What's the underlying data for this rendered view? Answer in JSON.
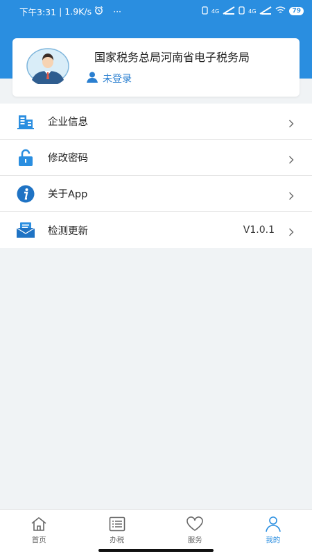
{
  "status_bar": {
    "time": "下午3:31",
    "speed": "1.9K/s",
    "dots": "···",
    "network_label": "4G",
    "battery": "79"
  },
  "profile": {
    "org_name": "国家税务总局河南省电子税务局",
    "login_status": "未登录"
  },
  "menu": {
    "items": [
      {
        "label": "企业信息",
        "icon": "building-icon",
        "value": ""
      },
      {
        "label": "修改密码",
        "icon": "lock-icon",
        "value": ""
      },
      {
        "label": "关于App",
        "icon": "info-icon",
        "value": ""
      },
      {
        "label": "检测更新",
        "icon": "mail-icon",
        "value": "V1.0.1"
      }
    ]
  },
  "bottom_nav": {
    "items": [
      {
        "label": "首页",
        "icon": "home-icon"
      },
      {
        "label": "办税",
        "icon": "list-icon"
      },
      {
        "label": "服务",
        "icon": "heart-icon"
      },
      {
        "label": "我的",
        "icon": "person-icon"
      }
    ]
  },
  "colors": {
    "accent": "#2a8ee0",
    "background": "#f0f3f5"
  }
}
